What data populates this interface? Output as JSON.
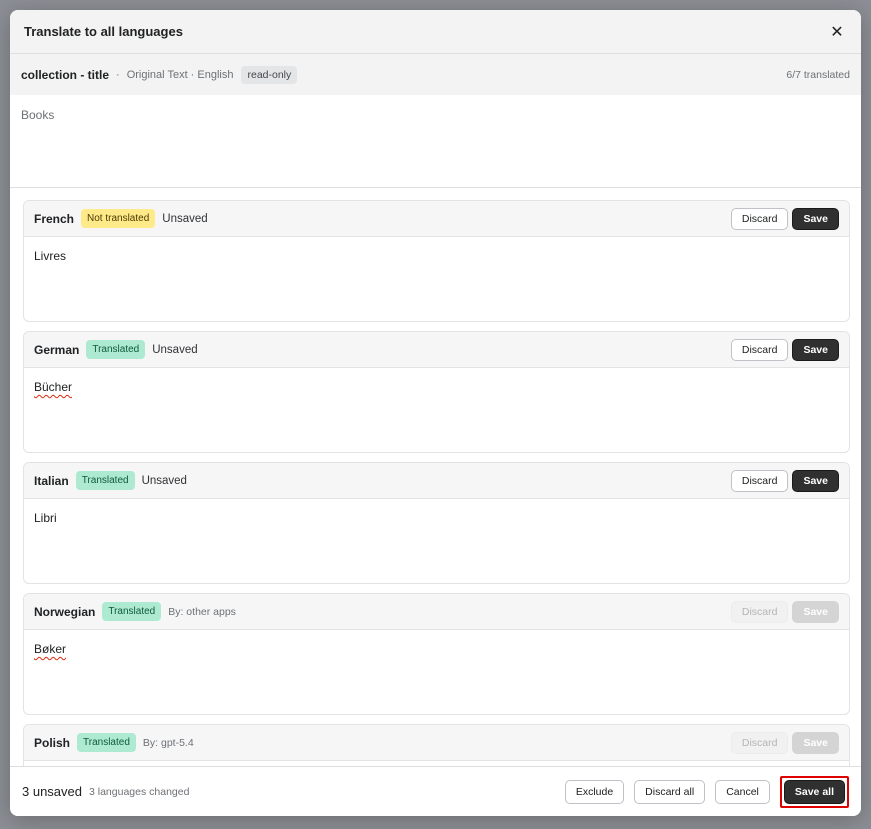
{
  "modal": {
    "title": "Translate to all languages",
    "close_icon": "close-icon"
  },
  "original": {
    "key": "collection - title",
    "separator": "·",
    "subtitle": "Original Text · English",
    "badge": "read-only",
    "count": "6/7 translated",
    "text": "Books"
  },
  "languages": [
    {
      "name": "French",
      "status": "Not translated",
      "meta": "Unsaved",
      "text": "Livres",
      "discard": "Discard",
      "save": "Save"
    },
    {
      "name": "German",
      "status": "Translated",
      "meta": "Unsaved",
      "text": "Bücher",
      "discard": "Discard",
      "save": "Save"
    },
    {
      "name": "Italian",
      "status": "Translated",
      "meta": "Unsaved",
      "text": "Libri",
      "discard": "Discard",
      "save": "Save"
    },
    {
      "name": "Norwegian",
      "status": "Translated",
      "meta": "By: other apps",
      "text": "Bøker",
      "discard": "Discard",
      "save": "Save"
    },
    {
      "name": "Polish",
      "status": "Translated",
      "meta": "By: gpt-5.4",
      "text": "",
      "discard": "Discard",
      "save": "Save"
    }
  ],
  "footer": {
    "unsaved": "3 unsaved",
    "changed": "3 languages changed",
    "exclude": "Exclude",
    "discard_all": "Discard all",
    "cancel": "Cancel",
    "save_all": "Save all"
  },
  "colors": {
    "not_translated_badge": "#ffea8a",
    "translated_badge": "#aee9d1",
    "primary_button": "#303030",
    "highlight": "#e00000"
  }
}
